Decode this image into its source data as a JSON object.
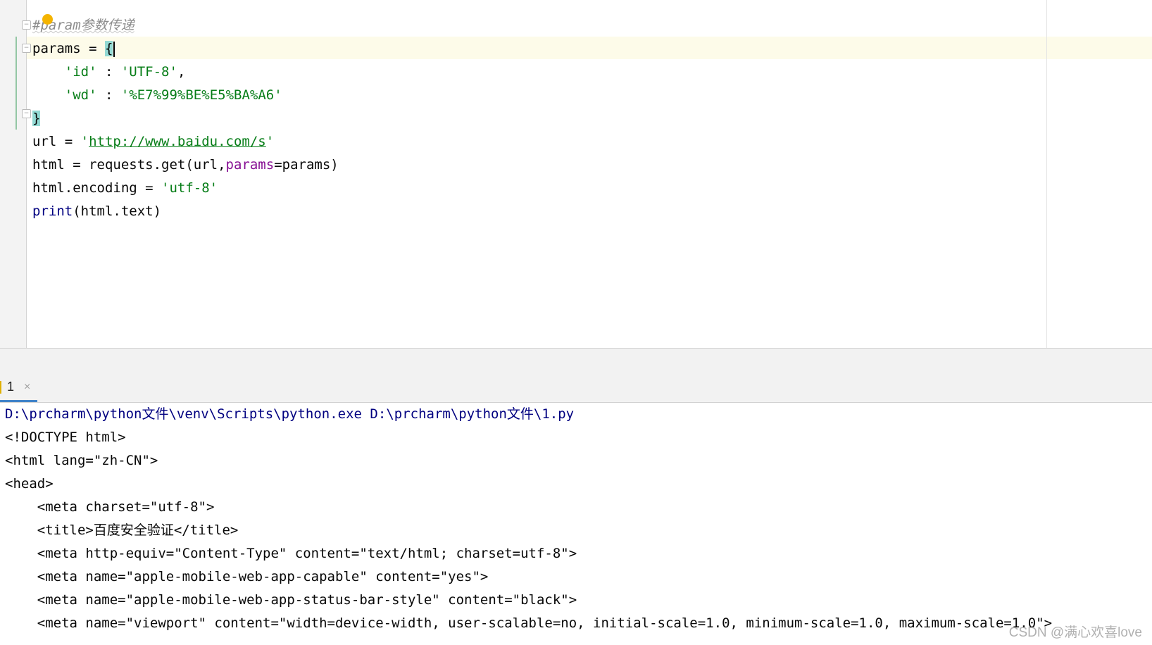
{
  "editor": {
    "lines": {
      "l1_comment": "#param参数传递",
      "l2_prefix": "params = ",
      "l2_brace": "{",
      "l3_indent": "    ",
      "l3_key": "'id'",
      "l3_sep": " : ",
      "l3_val": "'UTF-8'",
      "l3_end": ",",
      "l4_indent": "    ",
      "l4_key": "'wd'",
      "l4_sep": " : ",
      "l4_val": "'%E7%99%BE%E5%BA%A6'",
      "l5_brace": "}",
      "l6_prefix": "url = ",
      "l6_q1": "'",
      "l6_url": "http://www.baidu.com/s",
      "l6_q2": "'",
      "l7_prefix": "html = requests.get(url,",
      "l7_param": "params",
      "l7_suffix": "=params)",
      "l8_prefix": "html.encoding = ",
      "l8_val": "'utf-8'",
      "l9_fn": "print",
      "l9_rest": "(html.text)"
    }
  },
  "run_panel": {
    "tab_label": "1",
    "close_glyph": "×"
  },
  "console": {
    "command": "D:\\prcharm\\python文件\\venv\\Scripts\\python.exe D:\\prcharm\\python文件\\1.py",
    "output": [
      "<!DOCTYPE html>",
      "<html lang=\"zh-CN\">",
      "<head>",
      "    <meta charset=\"utf-8\">",
      "    <title>百度安全验证</title>",
      "    <meta http-equiv=\"Content-Type\" content=\"text/html; charset=utf-8\">",
      "    <meta name=\"apple-mobile-web-app-capable\" content=\"yes\">",
      "    <meta name=\"apple-mobile-web-app-status-bar-style\" content=\"black\">",
      "    <meta name=\"viewport\" content=\"width=device-width, user-scalable=no, initial-scale=1.0, minimum-scale=1.0, maximum-scale=1.0\">"
    ]
  },
  "watermark": "CSDN @满心欢喜love",
  "colors": {
    "string": "#067d17",
    "keyword": "#000080",
    "param": "#871094",
    "comment": "#8c8c8c",
    "brace_highlight": "#93d9d3",
    "current_line": "#fdfbe9"
  }
}
